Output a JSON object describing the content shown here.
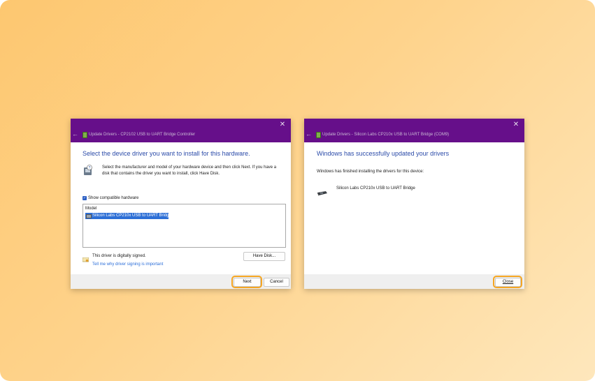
{
  "left_dialog": {
    "title": "Update Drivers - CP2102 USB to UART Bridge Controller",
    "heading": "Select the device driver you want to install for this hardware.",
    "description": "Select the manufacturer and model of your hardware device and then click Next. If you have a disk that contains the driver you want to install, click Have Disk.",
    "show_compatible_label": "Show compatible hardware",
    "list_header": "Model",
    "selected_model": "Silicon Labs CP210x USB to UART Bridge",
    "signed_text": "This driver is digitally signed.",
    "signing_link": "Tell me why driver signing is important",
    "have_disk_label": "Have Disk...",
    "next_label": "Next",
    "cancel_label": "Cancel",
    "close_glyph": "✕",
    "back_glyph": "←"
  },
  "right_dialog": {
    "title": "Update Drivers - Silicon Labs CP210x USB to UART Bridge (COM9)",
    "heading": "Windows has successfully updated your drivers",
    "description": "Windows has finished installing the drivers for this device:",
    "device_name": "Silicon Labs CP210x USB to UART Bridge",
    "close_label": "Close",
    "close_glyph": "✕",
    "back_glyph": "←"
  },
  "colors": {
    "titlebar": "#660f8a",
    "heading": "#2a4aa8",
    "highlight": "#f5a623",
    "selection": "#2d6fd6"
  }
}
